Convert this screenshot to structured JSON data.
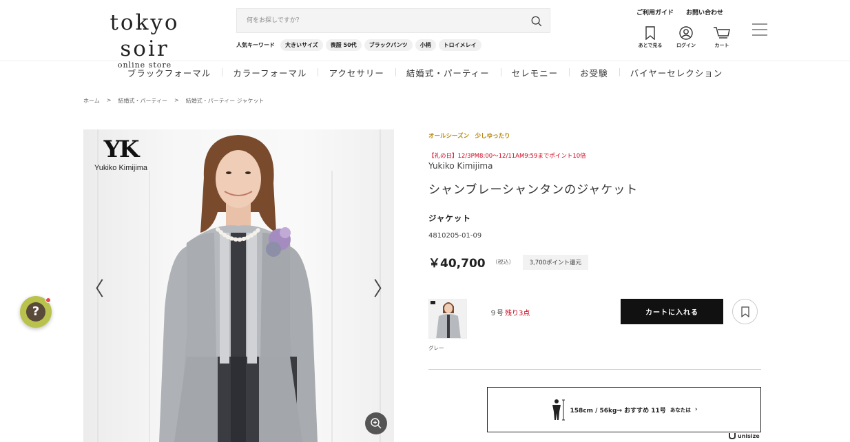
{
  "header": {
    "logo_main": "tokyo soir",
    "logo_sub": "online store",
    "search_placeholder": "何をお探しですか？",
    "keywords_label": "人気キーワード",
    "keywords": [
      "大きいサイズ",
      "喪服 50代",
      "ブラックパンツ",
      "小柄",
      "トロイメレイ"
    ],
    "top_links": [
      "ご利用ガイド",
      "お問い合わせ"
    ],
    "icons": [
      {
        "label": "あとで見る",
        "icon": "bookmark-icon"
      },
      {
        "label": "ログイン",
        "icon": "user-icon"
      },
      {
        "label": "カート",
        "icon": "cart-icon"
      }
    ]
  },
  "nav": [
    "ブラックフォーマル",
    "カラーフォーマル",
    "アクセサリー",
    "結婚式・パーティー",
    "セレモニー",
    "お受験",
    "バイヤーセレクション"
  ],
  "breadcrumb": [
    "ホーム",
    ">",
    "結婚式・パーティー",
    ">",
    "結婚式・パーティー ジャケット"
  ],
  "image": {
    "brand_logo": "YK",
    "brand_logo_name": "Yukiko Kimijima",
    "prev": "〈",
    "next": "〉"
  },
  "product": {
    "tags": "オールシーズン　少しゆったり",
    "promo": "【礼の日】12/3PM8:00〜12/11AM9:59までポイント10倍",
    "brand": "Yukiko Kimijima",
    "title": "シャンブレーシャンタンのジャケット",
    "category": "ジャケット",
    "code": "4810205-01-09",
    "price": "￥40,700",
    "tax": "（税込）",
    "points": "3,700ポイント還元",
    "color": "グレー",
    "size": "９号",
    "stock": "残り3点",
    "cart_label": "カートに入れる"
  },
  "unisize": {
    "text": "158cm / 56kg→ おすすめ 11号",
    "you": "あなたは",
    "brand": "unisize"
  },
  "help": "?",
  "colors": {
    "promo_red": "#d0021b",
    "tag_gold": "#b8860b",
    "help_green": "#b9c24c"
  }
}
